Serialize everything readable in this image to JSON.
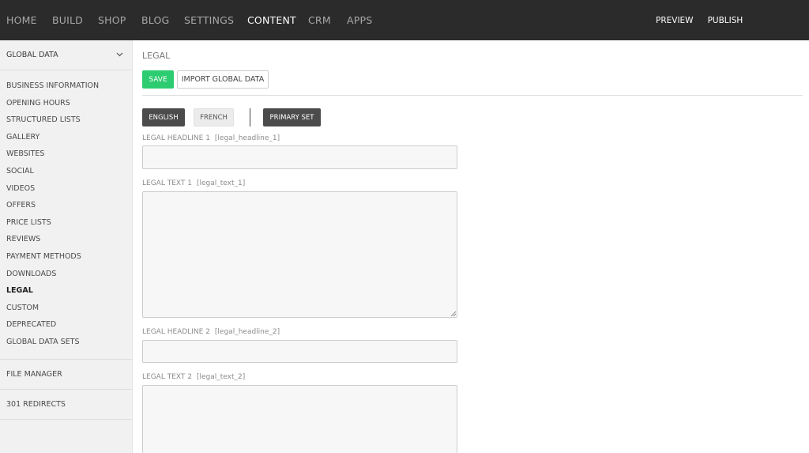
{
  "topnav": {
    "items": [
      {
        "label": "HOME"
      },
      {
        "label": "BUILD"
      },
      {
        "label": "SHOP"
      },
      {
        "label": "BLOG"
      },
      {
        "label": "SETTINGS"
      },
      {
        "label": "CONTENT",
        "active": true
      },
      {
        "label": "CRM"
      },
      {
        "label": "APPS"
      }
    ],
    "preview_label": "PREVIEW",
    "publish_label": "PUBLISH"
  },
  "sidebar": {
    "dropdown_label": "GLOBAL DATA",
    "items": [
      {
        "label": "BUSINESS INFORMATION"
      },
      {
        "label": "OPENING HOURS"
      },
      {
        "label": "STRUCTURED LISTS"
      },
      {
        "label": "GALLERY"
      },
      {
        "label": "WEBSITES"
      },
      {
        "label": "SOCIAL"
      },
      {
        "label": "VIDEOS"
      },
      {
        "label": "OFFERS"
      },
      {
        "label": "PRICE LISTS"
      },
      {
        "label": "REVIEWS"
      },
      {
        "label": "PAYMENT METHODS"
      },
      {
        "label": "DOWNLOADS"
      },
      {
        "label": "LEGAL",
        "active": true
      },
      {
        "label": "CUSTOM"
      },
      {
        "label": "DEPRECATED"
      },
      {
        "label": "GLOBAL DATA SETS"
      }
    ],
    "file_manager_label": "FILE MANAGER",
    "redirects_label": "301 REDIRECTS"
  },
  "main": {
    "page_title": "LEGAL",
    "save_label": "SAVE",
    "import_label": "IMPORT GLOBAL DATA",
    "languages": [
      {
        "label": "ENGLISH",
        "selected": true
      },
      {
        "label": "FRENCH",
        "selected": false
      }
    ],
    "primary_set_label": "PRIMARY SET",
    "fields": [
      {
        "label": "LEGAL HEADLINE 1",
        "key": "[legal_headline_1]",
        "value": ""
      },
      {
        "label": "LEGAL TEXT 1",
        "key": "[legal_text_1]",
        "value": ""
      },
      {
        "label": "LEGAL HEADLINE 2",
        "key": "[legal_headline_2]",
        "value": ""
      },
      {
        "label": "LEGAL TEXT 2",
        "key": "[legal_text_2]",
        "value": ""
      }
    ]
  },
  "colors": {
    "topbar": "#2b2b2b",
    "save_button": "#2ecc71",
    "dark_button": "#4b4b4b",
    "sidebar": "#f1f1f1"
  }
}
